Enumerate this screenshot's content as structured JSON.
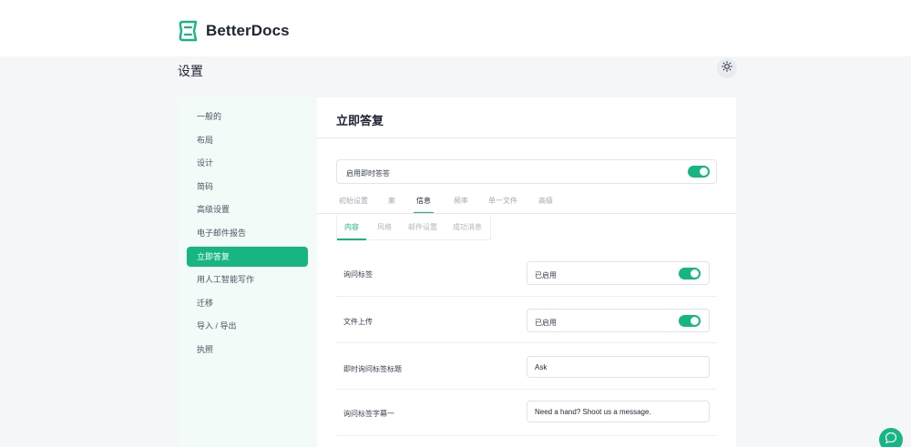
{
  "brand": {
    "name": "BetterDocs",
    "color": "#16b583"
  },
  "page": {
    "title": "设置"
  },
  "theme_toggle": {
    "icon": "sun-icon"
  },
  "sidebar": {
    "items": [
      {
        "label": "一般的",
        "active": false
      },
      {
        "label": "布局",
        "active": false
      },
      {
        "label": "设计",
        "active": false
      },
      {
        "label": "简码",
        "active": false
      },
      {
        "label": "高级设置",
        "active": false
      },
      {
        "label": "电子邮件报告",
        "active": false
      },
      {
        "label": "立即答复",
        "active": true
      },
      {
        "label": "用人工智能写作",
        "active": false
      },
      {
        "label": "迁移",
        "active": false
      },
      {
        "label": "导入 / 导出",
        "active": false
      },
      {
        "label": "执照",
        "active": false
      }
    ]
  },
  "content": {
    "title": "立即答复",
    "enable": {
      "label": "启用即时答答",
      "on": true
    },
    "tabs": [
      {
        "label": "初始设置",
        "active": false
      },
      {
        "label": "案",
        "active": false
      },
      {
        "label": "信息",
        "active": true
      },
      {
        "label": "频率",
        "active": false
      },
      {
        "label": "单一文件",
        "active": false
      },
      {
        "label": "高级",
        "active": false
      }
    ],
    "subtabs": [
      {
        "label": "内容",
        "active": true
      },
      {
        "label": "风格",
        "active": false
      },
      {
        "label": "邮件设置",
        "active": false
      },
      {
        "label": "成功消息",
        "active": false
      }
    ],
    "rows": [
      {
        "label": "询问标签",
        "type": "toggle",
        "value": "已启用",
        "on": true
      },
      {
        "label": "文件上传",
        "type": "toggle",
        "value": "已启用",
        "on": true
      },
      {
        "label": "即时询问标签标题",
        "type": "input",
        "value": "Ask"
      },
      {
        "label": "询问标签字幕一",
        "type": "input",
        "value": "Need a hand? Shoot us a message."
      }
    ]
  },
  "chat": {
    "icon": "chat-bubble-icon"
  }
}
